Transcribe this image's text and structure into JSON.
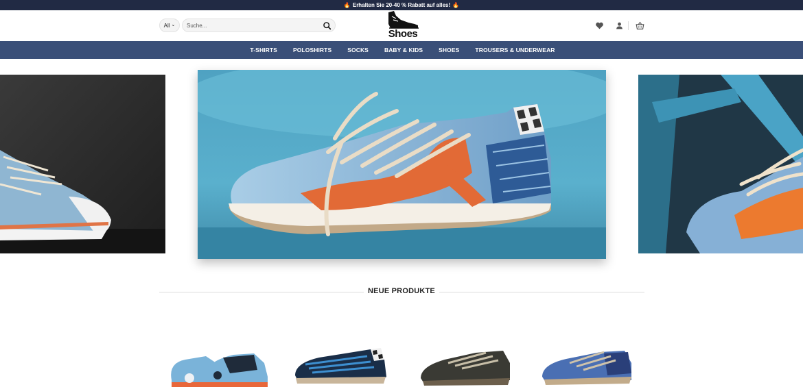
{
  "promo": {
    "text": "Erhalten Sie 20-40 % Rabatt auf alles!"
  },
  "header": {
    "category_select": "All",
    "search_placeholder": "Suche...",
    "logo_text": "Shoes"
  },
  "nav": {
    "items": [
      "T-SHIRTS",
      "POLOSHIRTS",
      "SOCKS",
      "BABY & KIDS",
      "SHOES",
      "TROUSERS & UNDERWEAR"
    ]
  },
  "section": {
    "title": "NEUE PRODUKTE"
  },
  "colors": {
    "promo_bg": "#212a44",
    "nav_bg": "#3a4f78",
    "accent_orange": "#e8683a",
    "shoe_blue": "#86b5d8"
  }
}
